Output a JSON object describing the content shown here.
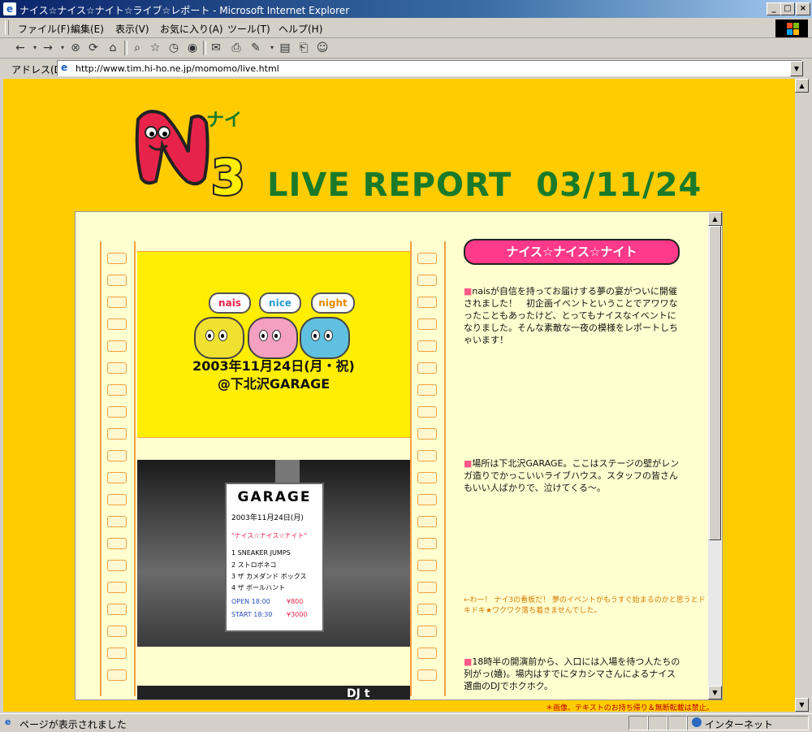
{
  "window": {
    "title": "ナイス☆ナイス☆ナイト☆ライブ☆レポート - Microsoft Internet Explorer",
    "icon": "ie-icon",
    "controls": [
      "_",
      "□",
      "×"
    ]
  },
  "menu": [
    "ファイル(F)",
    "編集(E)",
    "表示(V)",
    "お気に入り(A)",
    "ツール(T)",
    "ヘルプ(H)"
  ],
  "address": {
    "label": "アドレス(D)",
    "url": "http://www.tim.hi-ho.ne.jp/momomo/live.html"
  },
  "toolbar_icons": [
    "back-icon",
    "forward-icon",
    "stop-icon",
    "refresh-icon",
    "home-icon",
    "search-icon",
    "favorites-icon",
    "history-icon",
    "mail-icon",
    "print-icon",
    "edit-icon",
    "discuss-icon",
    "messenger-icon"
  ],
  "header": {
    "logo_kana": "ナイ",
    "logo_num": "3",
    "title": "LIVE REPORT  03/11/24"
  },
  "flyer": {
    "bubbles": [
      "nais",
      "nice",
      "night"
    ],
    "date": "2003年11月24日(月・祝)",
    "venue": "@下北沢GARAGE"
  },
  "sign": {
    "title": "GARAGE",
    "date": "2003年11月24日(月)",
    "event": "\"ナイス☆ナイス☆ナイト\"",
    "lineup": [
      "1 SNEAKER JUMPS",
      "2 ストロボネコ",
      "3 ザ カメダンド ボックス",
      "4 ザ ボールハント"
    ],
    "open": "OPEN 18:00",
    "start": "START 18:30",
    "price": "¥800",
    "fee": "¥3000"
  },
  "photo3_label": "DJ t",
  "article": {
    "badge": "ナイス☆ナイス☆ナイト",
    "para1": "naisが自信を持ってお届けする夢の宴がついに開催されました！　初企画イベントということでアワワなったこともあったけど、とってもナイスなイベントになりました。そんな素敵な一夜の模様をレポートしちゃいます！",
    "para2": "場所は下北沢GARAGE。ここはステージの壁がレンガ造りでかっこいいライブハウス。スタッフの皆さんもいい人ばかりで、泣けてくる〜。",
    "caption": "←わー！ ナイ3の看板だ！ 夢のイベントがもうすぐ始まるのかと思うとドキドキ★ワクワク落ち着きませんでした。",
    "para3": "18時半の開演前から、入口には入場を待つ人たちの列がっ(嬉)。場内はすでにタカシマさんによるナイス選曲のDJでホクホク。",
    "bullet": "■"
  },
  "footer": "＊画像、テキストのお持ち帰り＆無断転載は禁止。",
  "status": {
    "text": "ページが表示されました",
    "zone": "インターネット"
  },
  "colors": {
    "page_bg": "#ffcc00",
    "frame_bg": "#ffffd0",
    "logo_green": "#1a7a2a",
    "badge_pink": "#ff3a8a"
  }
}
